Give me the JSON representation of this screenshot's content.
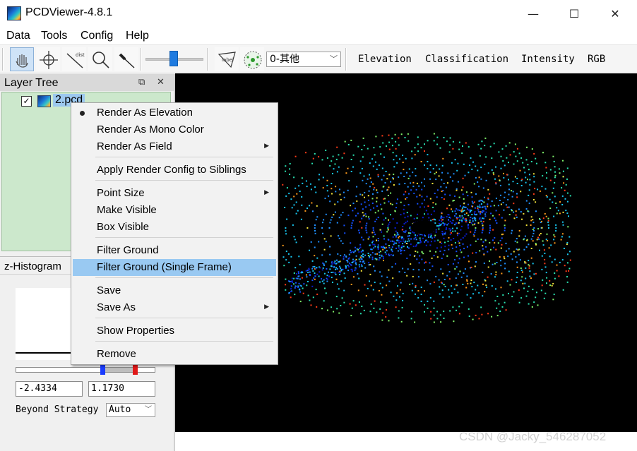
{
  "window": {
    "title": "PCDViewer-4.8.1",
    "minimize": "—",
    "maximize": "☐",
    "close": "✕"
  },
  "menubar": {
    "items": [
      "Data",
      "Tools",
      "Config",
      "Help"
    ]
  },
  "toolbar": {
    "class_combo": {
      "value": "0-其他"
    },
    "mode_tabs": [
      "Elevation",
      "Classification",
      "Intensity",
      "RGB"
    ],
    "dist_label": "dist",
    "label_label": "label"
  },
  "layer_tree": {
    "title": "Layer Tree",
    "float_icon": "⧉",
    "close_icon": "✕",
    "item": {
      "name": "2.pcd",
      "checked": "✓"
    }
  },
  "histogram": {
    "title": "z-Histogram",
    "min_value": "-2.4334",
    "max_value": "1.1730",
    "beyond_label": "Beyond Strategy",
    "beyond_value": "Auto"
  },
  "context_menu": {
    "items": [
      {
        "label": "Render As Elevation",
        "checked": true,
        "submenu": false,
        "highlighted": false
      },
      {
        "label": "Render As Mono Color",
        "checked": false,
        "submenu": false,
        "highlighted": false
      },
      {
        "label": "Render As Field",
        "checked": false,
        "submenu": true,
        "highlighted": false
      },
      {
        "label": "Apply Render Config to Siblings",
        "checked": false,
        "submenu": false,
        "highlighted": false
      },
      {
        "label": "Point Size",
        "checked": false,
        "submenu": true,
        "highlighted": false
      },
      {
        "label": "Make Visible",
        "checked": false,
        "submenu": false,
        "highlighted": false
      },
      {
        "label": "Box Visible",
        "checked": false,
        "submenu": false,
        "highlighted": false
      },
      {
        "label": "Filter Ground",
        "checked": false,
        "submenu": false,
        "highlighted": false
      },
      {
        "label": "Filter Ground (Single Frame)",
        "checked": false,
        "submenu": false,
        "highlighted": true
      },
      {
        "label": "Save",
        "checked": false,
        "submenu": false,
        "highlighted": false
      },
      {
        "label": "Save As",
        "checked": false,
        "submenu": true,
        "highlighted": false
      },
      {
        "label": "Show Properties",
        "checked": false,
        "submenu": false,
        "highlighted": false
      },
      {
        "label": "Remove",
        "checked": false,
        "submenu": false,
        "highlighted": false
      }
    ],
    "submenu_arrow": "▶"
  },
  "watermark": "CSDN @Jacky_546287052",
  "colors": {
    "accent": "#1f7be0",
    "highlight": "#99c9f2",
    "tree_bg": "#cce8cc",
    "viewer_bg": "#000000"
  }
}
